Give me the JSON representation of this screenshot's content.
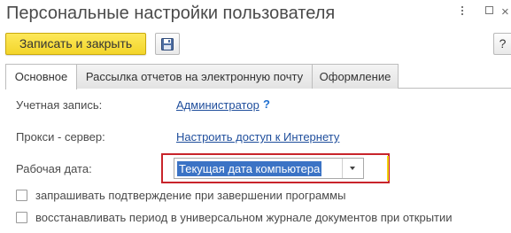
{
  "window": {
    "title": "Персональные настройки пользователя",
    "more_icon": "more-vertical-icon",
    "restore_icon": "restore-window-icon",
    "close_glyph": "×"
  },
  "toolbar": {
    "save_close_label": "Записать и закрыть",
    "save_icon": "floppy-disk-icon",
    "help_label": "?"
  },
  "tabs": [
    {
      "label": "Основное",
      "active": true
    },
    {
      "label": "Рассылка отчетов на электронную почту",
      "active": false
    },
    {
      "label": "Оформление",
      "active": false
    }
  ],
  "form": {
    "account_label": "Учетная запись:",
    "account_value": "Администратор",
    "account_help": "?",
    "proxy_label": "Прокси - сервер:",
    "proxy_link": "Настроить доступ к Интернету",
    "work_date_label": "Рабочая дата:",
    "work_date_value": "Текущая дата компьютера",
    "checkboxes": [
      {
        "label": "запрашивать подтверждение при завершении программы",
        "checked": false
      },
      {
        "label": "восстанавливать период в универсальном журнале документов при открытии",
        "checked": false
      }
    ]
  },
  "colors": {
    "primary_button": "#f3d52a",
    "link": "#1f4e9c",
    "highlight_frame": "#c8242b",
    "selection": "#3b73c5"
  }
}
